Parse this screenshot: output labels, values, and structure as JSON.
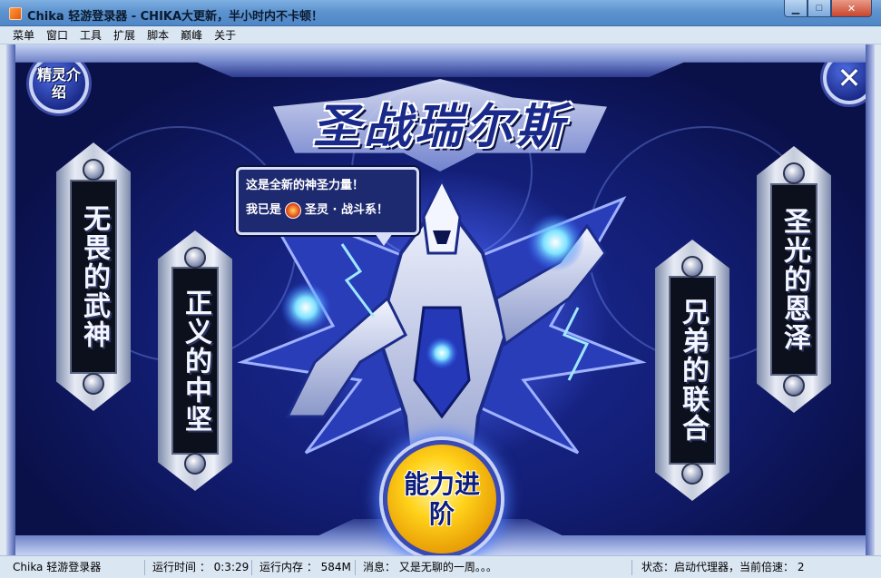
{
  "window": {
    "title": "Chika 轻游登录器 - CHIKA大更新，半小时内不卡顿！",
    "minimize_glyph": "▁",
    "maximize_glyph": "□",
    "close_glyph": "✕"
  },
  "menu": {
    "items": [
      "菜单",
      "窗口",
      "工具",
      "扩展",
      "脚本",
      "巅峰",
      "关于"
    ]
  },
  "game": {
    "logo": "圣战瑞尔斯",
    "spirit_intro": "精灵介绍",
    "close_icon": "✕",
    "bubble": {
      "line1": "这是全新的神圣力量！",
      "line2_prefix": "我已是",
      "line2_suffix": "圣灵 · 战斗系！"
    },
    "banners": [
      "无畏的武神",
      "正义的中坚",
      "兄弟的联合",
      "圣光的恩泽"
    ],
    "ability_button": "能力进阶"
  },
  "status": {
    "app": "Chika 轻游登录器",
    "runtime": "运行时间 ： 0:3:29",
    "memory": "运行内存 ： 584M",
    "message": "消息：  又是无聊的一周。。。",
    "state": "状态：启动代理器，当前倍速：  2"
  },
  "colors": {
    "titlebar": "#5d93cf",
    "game_bg": "#121d72",
    "accent_gold": "#ffd21a"
  }
}
